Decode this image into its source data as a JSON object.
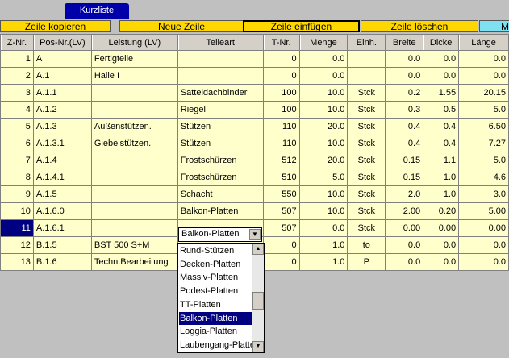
{
  "tab_label": "Kurzliste",
  "toolbar": {
    "copy_row": "Zeile kopieren",
    "new_row": "Neue Zeile",
    "insert_row": "Zeile einfügen",
    "delete_row": "Zeile löschen",
    "more": "Ma"
  },
  "columns": [
    "Z-Nr.",
    "Pos-Nr.(LV)",
    "Leistung (LV)",
    "Teileart",
    "T-Nr.",
    "Menge",
    "Einh.",
    "Breite",
    "Dicke",
    "Länge"
  ],
  "rows": [
    [
      "1",
      "A",
      "Fertigteile",
      "",
      "0",
      "0.0",
      "",
      "0.0",
      "0.0",
      "0.0"
    ],
    [
      "2",
      "A.1",
      "Halle I",
      "",
      "0",
      "0.0",
      "",
      "0.0",
      "0.0",
      "0.0"
    ],
    [
      "3",
      "A.1.1",
      "",
      "Satteldachbinder",
      "100",
      "10.0",
      "Stck",
      "0.2",
      "1.55",
      "20.15"
    ],
    [
      "4",
      "A.1.2",
      "",
      "Riegel",
      "100",
      "10.0",
      "Stck",
      "0.3",
      "0.5",
      "5.0"
    ],
    [
      "5",
      "A.1.3",
      "Außenstützen.",
      "Stützen",
      "110",
      "20.0",
      "Stck",
      "0.4",
      "0.4",
      "6.50"
    ],
    [
      "6",
      "A.1.3.1",
      "Giebelstützen.",
      "Stützen",
      "110",
      "10.0",
      "Stck",
      "0.4",
      "0.4",
      "7.27"
    ],
    [
      "7",
      "A.1.4",
      "",
      "Frostschürzen",
      "512",
      "20.0",
      "Stck",
      "0.15",
      "1.1",
      "5.0"
    ],
    [
      "8",
      "A.1.4.1",
      "",
      "Frostschürzen",
      "510",
      "5.0",
      "Stck",
      "0.15",
      "1.0",
      "4.6"
    ],
    [
      "9",
      "A.1.5",
      "",
      "Schacht",
      "550",
      "10.0",
      "Stck",
      "2.0",
      "1.0",
      "3.0"
    ],
    [
      "10",
      "A.1.6.0",
      "",
      "Balkon-Platten",
      "507",
      "10.0",
      "Stck",
      "2.00",
      "0.20",
      "5.00"
    ],
    [
      "11",
      "A.1.6.1",
      "",
      "",
      "507",
      "0.0",
      "Stck",
      "0.00",
      "0.00",
      "0.00"
    ],
    [
      "12",
      "B.1.5",
      "BST 500 S+M",
      "",
      "0",
      "1.0",
      "to",
      "0.0",
      "0.0",
      "0.0"
    ],
    [
      "13",
      "B.1.6",
      "Techn.Bearbeitung",
      "",
      "0",
      "1.0",
      "P",
      "0.0",
      "0.0",
      "0.0"
    ]
  ],
  "combo": {
    "value": "Balkon-Platten"
  },
  "dropdown_items": [
    "Rund-Stützen",
    "Decken-Platten",
    "Massiv-Platten",
    "Podest-Platten",
    "TT-Platten",
    "Balkon-Platten",
    "Loggia-Platten",
    "Laubengang-Platten"
  ],
  "dropdown_selected_index": 5
}
